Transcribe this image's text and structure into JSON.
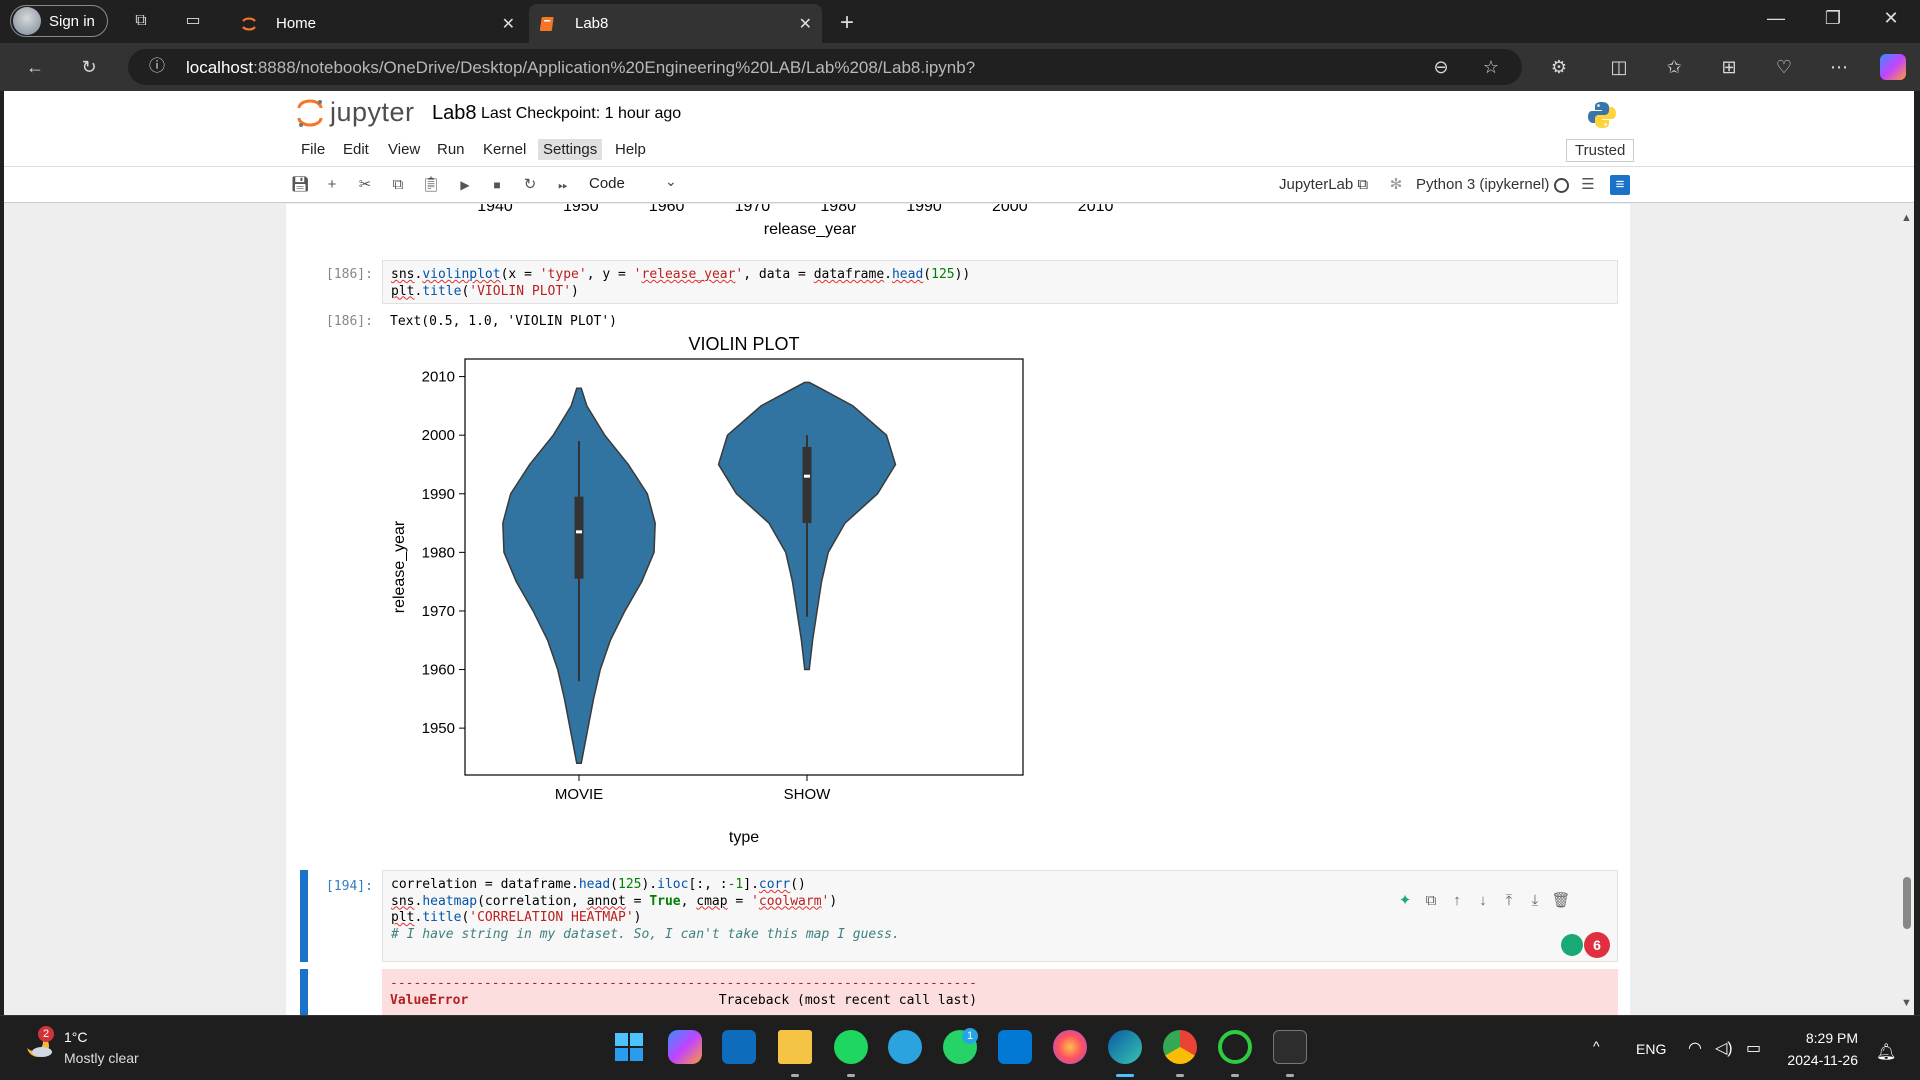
{
  "browser": {
    "signin_label": "Sign in",
    "tabs": [
      {
        "title": "Home"
      },
      {
        "title": "Lab8"
      }
    ],
    "url_host": "localhost",
    "url_path": ":8888/notebooks/OneDrive/Desktop/Application%20Engineering%20LAB/Lab%208/Lab8.ipynb?"
  },
  "jupyter": {
    "logo_text": "jupyter",
    "notebook_title": "Lab8",
    "checkpoint": "Last Checkpoint: 1 hour ago",
    "menu": [
      "File",
      "Edit",
      "View",
      "Run",
      "Kernel",
      "Settings",
      "Help"
    ],
    "trusted": "Trusted",
    "cell_type": "Code",
    "jupyterlab_link": "JupyterLab",
    "kernel": "Python 3 (ipykernel)"
  },
  "cells": {
    "prev_output_xticks": [
      "1940",
      "1950",
      "1960",
      "1970",
      "1980",
      "1990",
      "2000",
      "2010"
    ],
    "prev_output_xlabel": "release_year",
    "cell186_prompt": "[186]:",
    "cell186_out_prompt": "[186]:",
    "cell186_output_text": "Text(0.5, 1.0, 'VIOLIN PLOT')",
    "cell194_prompt": "[194]:",
    "cell194_comment": "# I have string in my dataset. So, I can't take this map I guess.",
    "error_dashes": "---------------------------------------------------------------------------",
    "error_type": "ValueError",
    "error_traceback": "Traceback (most recent call last)",
    "badge_count": "6"
  },
  "chart_data": {
    "type": "violin",
    "title": "VIOLIN PLOT",
    "xlabel": "type",
    "ylabel": "release_year",
    "categories": [
      "MOVIE",
      "SHOW"
    ],
    "ylim": [
      1942,
      2013
    ],
    "yticks": [
      1950,
      1960,
      1970,
      1980,
      1990,
      2000,
      2010
    ],
    "color": "#3274a1",
    "series": [
      {
        "category": "MOVIE",
        "min": 1944,
        "max": 2008,
        "q1": 1975.5,
        "median": 1983.5,
        "q3": 1989.5,
        "whisker_low": 1958,
        "whisker_high": 1999,
        "profile": [
          [
            1944,
            0.02
          ],
          [
            1950,
            0.08
          ],
          [
            1955,
            0.13
          ],
          [
            1960,
            0.19
          ],
          [
            1965,
            0.28
          ],
          [
            1970,
            0.41
          ],
          [
            1975,
            0.56
          ],
          [
            1980,
            0.67
          ],
          [
            1985,
            0.68
          ],
          [
            1990,
            0.61
          ],
          [
            1995,
            0.44
          ],
          [
            2000,
            0.23
          ],
          [
            2005,
            0.07
          ],
          [
            2008,
            0.02
          ]
        ]
      },
      {
        "category": "SHOW",
        "min": 1960,
        "max": 2009,
        "q1": 1985,
        "median": 1993,
        "q3": 1998,
        "whisker_low": 1969,
        "whisker_high": 2000,
        "profile": [
          [
            1960,
            0.02
          ],
          [
            1965,
            0.05
          ],
          [
            1970,
            0.09
          ],
          [
            1975,
            0.13
          ],
          [
            1980,
            0.19
          ],
          [
            1985,
            0.34
          ],
          [
            1990,
            0.63
          ],
          [
            1995,
            0.79
          ],
          [
            2000,
            0.71
          ],
          [
            2005,
            0.41
          ],
          [
            2008,
            0.12
          ],
          [
            2009,
            0.02
          ]
        ]
      }
    ]
  },
  "taskbar": {
    "weather_badge": "2",
    "temp": "1°C",
    "weather_desc": "Mostly clear",
    "language": "ENG",
    "time": "8:29 PM",
    "date": "2024-11-26",
    "whatsapp_badge": "1"
  }
}
